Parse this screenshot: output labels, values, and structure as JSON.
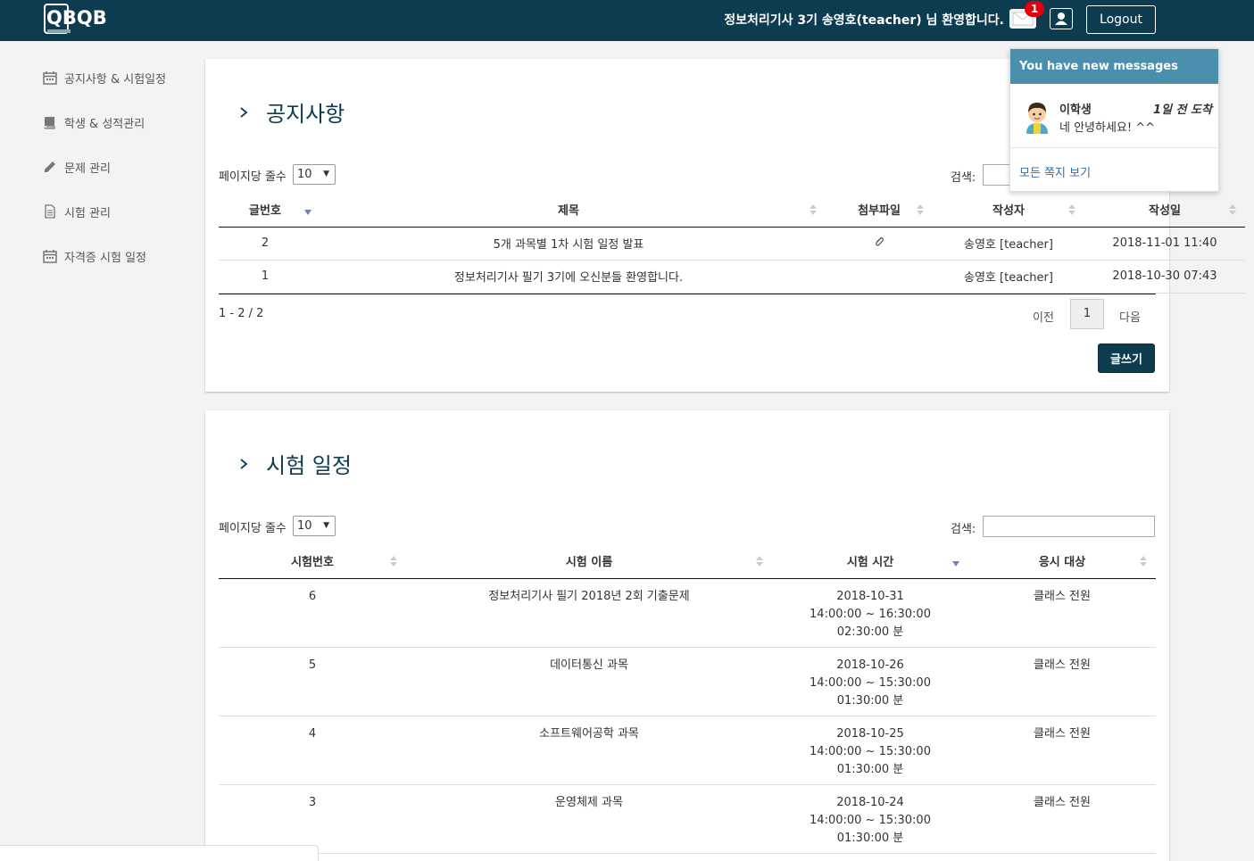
{
  "navbar": {
    "logo_text": "QBQB",
    "welcome": "정보처리기사 3기 송영호(teacher) 님 환영합니다.",
    "message_count": "1",
    "logout_label": "Logout"
  },
  "sidebar": {
    "items": [
      {
        "label": "공지사항 & 시험일정",
        "icon": "calendar-icon"
      },
      {
        "label": "학생 & 성적관리",
        "icon": "book-icon"
      },
      {
        "label": "문제 관리",
        "icon": "pencil-icon"
      },
      {
        "label": "시험 관리",
        "icon": "document-icon"
      },
      {
        "label": "자격증 시험 일정",
        "icon": "calendar-icon"
      }
    ]
  },
  "notice": {
    "title": "공지사항",
    "per_page_label": "페이지당 줄수",
    "per_page_value": "10",
    "search_label": "검색:",
    "columns": [
      "글번호",
      "제목",
      "첨부파일",
      "작성자",
      "작성일"
    ],
    "rows": [
      {
        "no": "2",
        "title": "5개 과목별 1차 시험 일정 발표",
        "attachment": true,
        "author": "송영호 [teacher]",
        "date": "2018-11-01 11:40"
      },
      {
        "no": "1",
        "title": "정보처리기사 필기 3기에 오신분들 환영합니다.",
        "attachment": false,
        "author": "송영호 [teacher]",
        "date": "2018-10-30 07:43"
      }
    ],
    "info": "1 - 2 / 2",
    "prev_label": "이전",
    "page": "1",
    "next_label": "다음",
    "write_label": "글쓰기"
  },
  "schedule": {
    "title": "시험 일정",
    "per_page_label": "페이지당 줄수",
    "per_page_value": "10",
    "search_label": "검색:",
    "columns": [
      "시험번호",
      "시험 이름",
      "시험 시간",
      "응시 대상"
    ],
    "rows": [
      {
        "no": "6",
        "name": "정보처리기사 필기 2018년 2회 기출문제",
        "date": "2018-10-31",
        "time": "14:00:00 ~ 16:30:00",
        "duration": "02:30:00 분",
        "target": "클래스 전원"
      },
      {
        "no": "5",
        "name": "데이터통신 과목",
        "date": "2018-10-26",
        "time": "14:00:00 ~ 15:30:00",
        "duration": "01:30:00 분",
        "target": "클래스 전원"
      },
      {
        "no": "4",
        "name": "소프트웨어공학 과목",
        "date": "2018-10-25",
        "time": "14:00:00 ~ 15:30:00",
        "duration": "01:30:00 분",
        "target": "클래스 전원"
      },
      {
        "no": "3",
        "name": "운영체제 과목",
        "date": "2018-10-24",
        "time": "14:00:00 ~ 15:30:00",
        "duration": "01:30:00 분",
        "target": "클래스 전원"
      }
    ]
  },
  "messages": {
    "header": "You have new messages",
    "sender": "이학생",
    "arrived": "1일 전 도착",
    "preview": "네 안녕하세요! ^^",
    "view_all": "모든 쪽지 보기"
  },
  "colors": {
    "navbar": "#0d3b50",
    "accent": "#4a8fae",
    "badge": "#e3000b",
    "link": "#2c6fa8"
  }
}
